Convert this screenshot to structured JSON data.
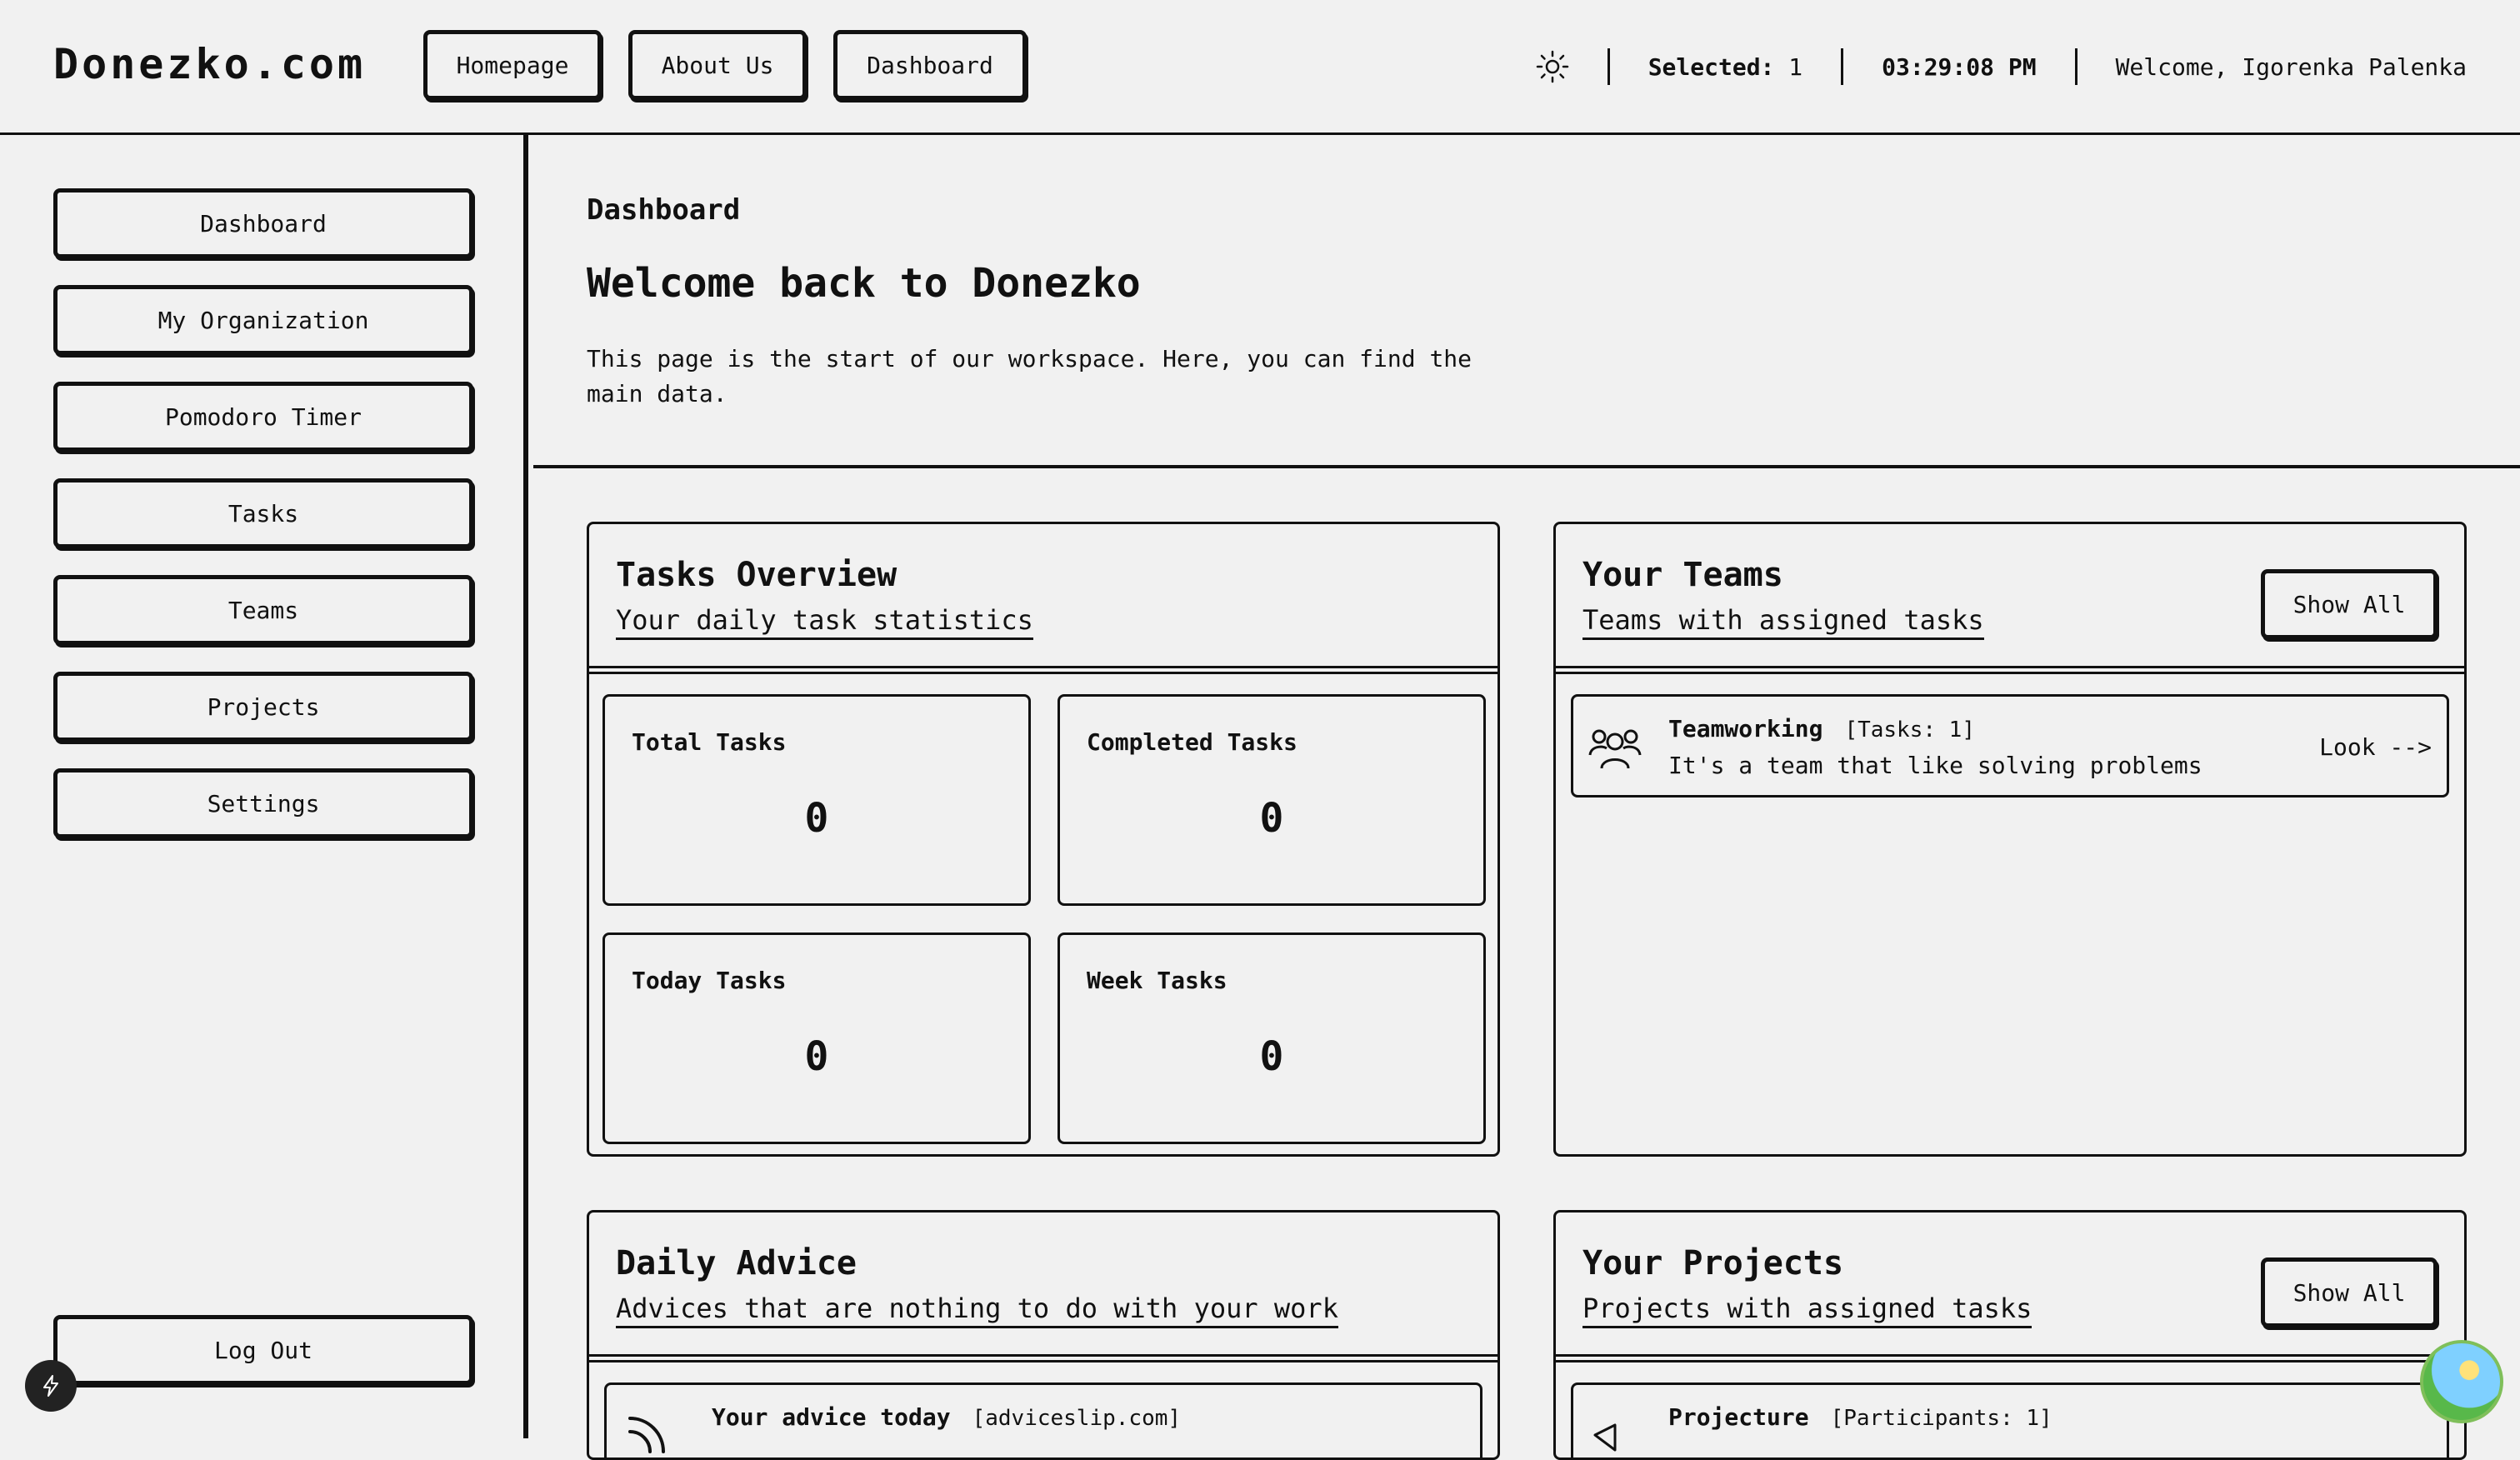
{
  "header": {
    "logo": "Donezko.com",
    "nav": [
      "Homepage",
      "About Us",
      "Dashboard"
    ],
    "selected_label": "Selected:",
    "selected_value": "1",
    "time": "03:29:08 PM",
    "welcome": "Welcome, Igorenka Palenka"
  },
  "sidebar": {
    "items": [
      "Dashboard",
      "My Organization",
      "Pomodoro Timer",
      "Tasks",
      "Teams",
      "Projects",
      "Settings"
    ],
    "logout": "Log Out"
  },
  "page": {
    "breadcrumb": "Dashboard",
    "title": "Welcome back to Donezko",
    "description": "This page is the start of our workspace. Here, you can find the main data."
  },
  "tasks_overview": {
    "title": "Tasks Overview",
    "subtitle": "Your daily task statistics",
    "stats": [
      {
        "label": "Total Tasks",
        "value": "0"
      },
      {
        "label": "Completed Tasks",
        "value": "0"
      },
      {
        "label": "Today Tasks",
        "value": "0"
      },
      {
        "label": "Week Tasks",
        "value": "0"
      }
    ]
  },
  "teams": {
    "title": "Your Teams",
    "subtitle": "Teams with assigned tasks",
    "show_all": "Show All",
    "items": [
      {
        "name": "Teamworking",
        "tag": "[Tasks: 1]",
        "description": "It's a team that like solving problems",
        "link": "Look -->"
      }
    ]
  },
  "advice": {
    "title": "Daily Advice",
    "subtitle": "Advices that are nothing to do with your work",
    "item_title": "Your advice today",
    "item_tag": "[adviceslip.com]"
  },
  "projects": {
    "title": "Your Projects",
    "subtitle": "Projects with assigned tasks",
    "show_all": "Show All",
    "item_name": "Projecture",
    "item_tag": "[Participants: 1]"
  }
}
